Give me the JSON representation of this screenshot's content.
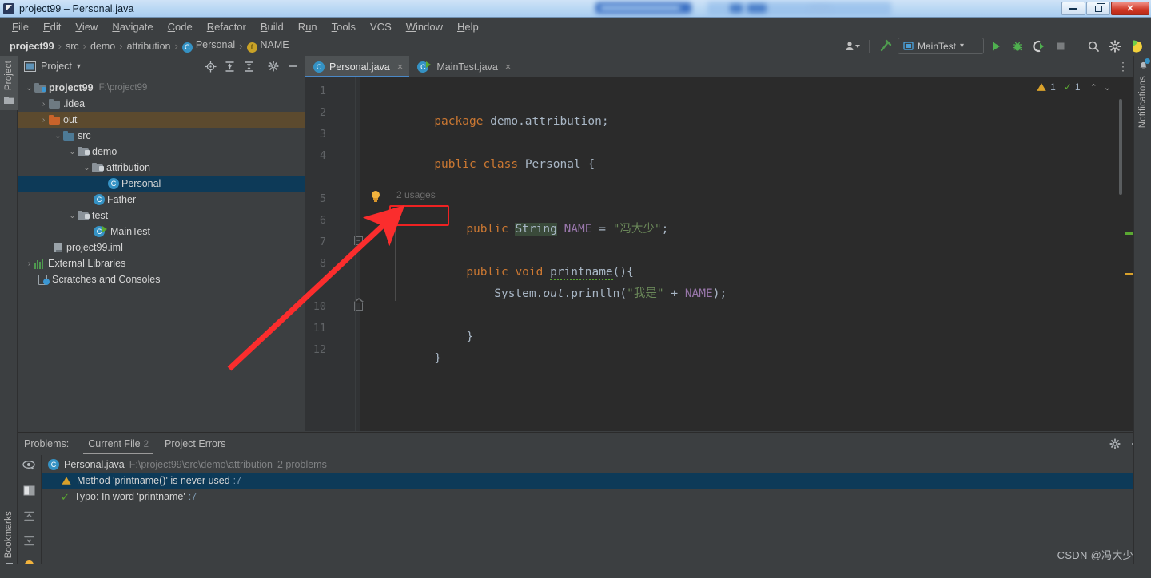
{
  "window": {
    "title": "project99 – Personal.java",
    "app_icon": "intellij-idea-icon",
    "controls": {
      "minimize": "minimize-icon",
      "restore": "restore-icon",
      "close": "close-icon"
    }
  },
  "menubar": {
    "items": [
      {
        "label": "File",
        "mnemonic": "F"
      },
      {
        "label": "Edit",
        "mnemonic": "E"
      },
      {
        "label": "View",
        "mnemonic": "V"
      },
      {
        "label": "Navigate",
        "mnemonic": "N"
      },
      {
        "label": "Code",
        "mnemonic": "C"
      },
      {
        "label": "Refactor",
        "mnemonic": "R"
      },
      {
        "label": "Build",
        "mnemonic": "B"
      },
      {
        "label": "Run",
        "mnemonic": "u"
      },
      {
        "label": "Tools",
        "mnemonic": "T"
      },
      {
        "label": "VCS",
        "mnemonic": ""
      },
      {
        "label": "Window",
        "mnemonic": "W"
      },
      {
        "label": "Help",
        "mnemonic": "H"
      }
    ]
  },
  "breadcrumb": {
    "items": [
      {
        "label": "project99",
        "icon": ""
      },
      {
        "label": "src",
        "icon": ""
      },
      {
        "label": "demo",
        "icon": ""
      },
      {
        "label": "attribution",
        "icon": ""
      },
      {
        "label": "Personal",
        "icon": "class-icon"
      },
      {
        "label": "NAME",
        "icon": "field-icon"
      }
    ],
    "separator": "›"
  },
  "toolbar": {
    "profile_icon": "user-profile-icon",
    "build_icon": "build-hammer-icon",
    "run_config": {
      "label": "MainTest",
      "icon": "run-config-icon",
      "caret": "▾"
    },
    "run_icon": "run-play-icon",
    "debug_icon": "debug-bug-icon",
    "run_coverage_icon": "run-with-coverage-icon",
    "stop_icon": "stop-icon",
    "search_icon": "search-everywhere-icon",
    "settings_icon": "gear-icon",
    "assistant_icon": "ai-assistant-icon"
  },
  "left_stripe": {
    "project_label": "Project",
    "bookmarks_label": "Bookmarks"
  },
  "right_stripe": {
    "notifications_label": "Notifications",
    "notifications_icon": "bell-icon"
  },
  "project_panel": {
    "title": "Project",
    "caret": "▾",
    "header_icons": [
      "locate-file-icon",
      "expand-all-icon",
      "collapse-all-icon",
      "gear-icon",
      "hide-icon"
    ],
    "tree": [
      {
        "label": "project99",
        "path": "F:\\project99",
        "depth": 0,
        "arrow": "⌄",
        "icon": "module-icon",
        "bold": true,
        "state": "normal"
      },
      {
        "label": ".idea",
        "path": "",
        "depth": 1,
        "arrow": "›",
        "icon": "folder-icon",
        "bold": false,
        "state": "normal"
      },
      {
        "label": "out",
        "path": "",
        "depth": 1,
        "arrow": "›",
        "icon": "folder-excluded-icon",
        "bold": false,
        "state": "hover"
      },
      {
        "label": "src",
        "path": "",
        "depth": 1,
        "arrow": "⌄",
        "icon": "source-folder-icon",
        "bold": false,
        "state": "normal"
      },
      {
        "label": "demo",
        "path": "",
        "depth": 2,
        "arrow": "⌄",
        "icon": "package-icon",
        "bold": false,
        "state": "normal"
      },
      {
        "label": "attribution",
        "path": "",
        "depth": 3,
        "arrow": "⌄",
        "icon": "package-icon",
        "bold": false,
        "state": "normal"
      },
      {
        "label": "Personal",
        "path": "",
        "depth": 4,
        "arrow": "",
        "icon": "java-class-icon",
        "bold": false,
        "state": "selected"
      },
      {
        "label": "Father",
        "path": "",
        "depth": 3,
        "arrow": "",
        "icon": "java-class-icon",
        "bold": false,
        "state": "normal"
      },
      {
        "label": "test",
        "path": "",
        "depth": 2,
        "arrow": "⌄",
        "icon": "package-icon",
        "bold": false,
        "state": "normal"
      },
      {
        "label": "MainTest",
        "path": "",
        "depth": 3,
        "arrow": "",
        "icon": "java-runnable-class-icon",
        "bold": false,
        "state": "normal"
      },
      {
        "label": "project99.iml",
        "path": "",
        "depth": 2,
        "arrow": "",
        "icon": "iml-file-icon",
        "bold": false,
        "state": "normal"
      },
      {
        "label": "External Libraries",
        "path": "",
        "depth": 0,
        "arrow": "›",
        "icon": "libraries-icon",
        "bold": false,
        "state": "normal"
      },
      {
        "label": "Scratches and Consoles",
        "path": "",
        "depth": 0,
        "arrow": "",
        "icon": "scratches-icon",
        "bold": false,
        "state": "normal"
      }
    ]
  },
  "editor": {
    "tabs": [
      {
        "label": "Personal.java",
        "icon": "java-class-icon",
        "active": true,
        "close": "×"
      },
      {
        "label": "MainTest.java",
        "icon": "java-runnable-class-icon",
        "active": false,
        "close": "×"
      }
    ],
    "kebab_icon": "more-options-icon",
    "inspections": {
      "warning_icon": "warning-triangle-icon",
      "warning_count": "1",
      "ok_icon": "inspection-ok-icon",
      "ok_count": "1",
      "prev_icon": "chevron-up-icon",
      "next_icon": "chevron-down-icon"
    },
    "line_numbers": [
      "1",
      "2",
      "3",
      "4",
      "5",
      "6",
      "7",
      "8",
      "",
      "10",
      "11",
      "12"
    ],
    "inlay_hint": "2 usages",
    "gutter_bulb_icon": "intention-bulb-icon",
    "code": {
      "line1": {
        "kw": "package",
        "rest": " demo.attribution;"
      },
      "line3": {
        "kw1": "public",
        "kw2": "class",
        "name": "Personal",
        "brace": "{"
      },
      "line5": {
        "kw": "public",
        "type": "String",
        "field": "NAME",
        "eq": "=",
        "value": "\"冯大少\"",
        "semi": ";"
      },
      "line7": {
        "kw1": "public",
        "kw2": "void",
        "method": "printname",
        "rest": "(){"
      },
      "line8": {
        "cls": "System",
        "dot1": ".",
        "stat": "out",
        "dot2": ".",
        "method": "println",
        "open": "(",
        "str": "\"我是\"",
        "plus": "+",
        "field": "NAME",
        "close": ");"
      },
      "line10": {
        "brace": "}"
      },
      "line11": {
        "brace": "}"
      }
    },
    "markers": [
      {
        "color": "#5aa832",
        "top": "167"
      },
      {
        "color": "#c9a227",
        "top": "218"
      }
    ]
  },
  "problems": {
    "label": "Problems:",
    "tabs": [
      {
        "label": "Current File",
        "count": "2",
        "active": true
      },
      {
        "label": "Project Errors",
        "count": "",
        "active": false
      }
    ],
    "header_icons": [
      "gear-icon",
      "hide-icon"
    ],
    "sidebar_icons": [
      "preview-eye-icon",
      "split-view-icon",
      "expand-all-icon",
      "collapse-all-icon",
      "intention-bulb-icon"
    ],
    "file_row": {
      "icon": "java-class-icon",
      "name": "Personal.java",
      "path": "F:\\project99\\src\\demo\\attribution",
      "count": "2 problems"
    },
    "rows": [
      {
        "icon": "warning-triangle-icon",
        "text": "Method 'printname()' is never used",
        "line": ":7",
        "selected": true
      },
      {
        "icon": "typo-icon",
        "text": "Typo: In word 'printname'",
        "line": ":7",
        "selected": false
      }
    ]
  },
  "annotation": {
    "arrow_color": "#fb2d2d",
    "highlight_box_color": "#ee2222",
    "highlight_target": "public"
  },
  "watermark": {
    "text": "CSDN @冯大少"
  },
  "colors": {
    "panel_bg": "#3c3f41",
    "editor_bg": "#2b2b2b",
    "gutter_bg": "#313335",
    "selection_blue": "#0d3a58",
    "accent_blue": "#4a88c7",
    "keyword_orange": "#cc7832",
    "field_purple": "#9876aa",
    "string_green": "#6a8759",
    "text_grey": "#a9b7c6"
  }
}
